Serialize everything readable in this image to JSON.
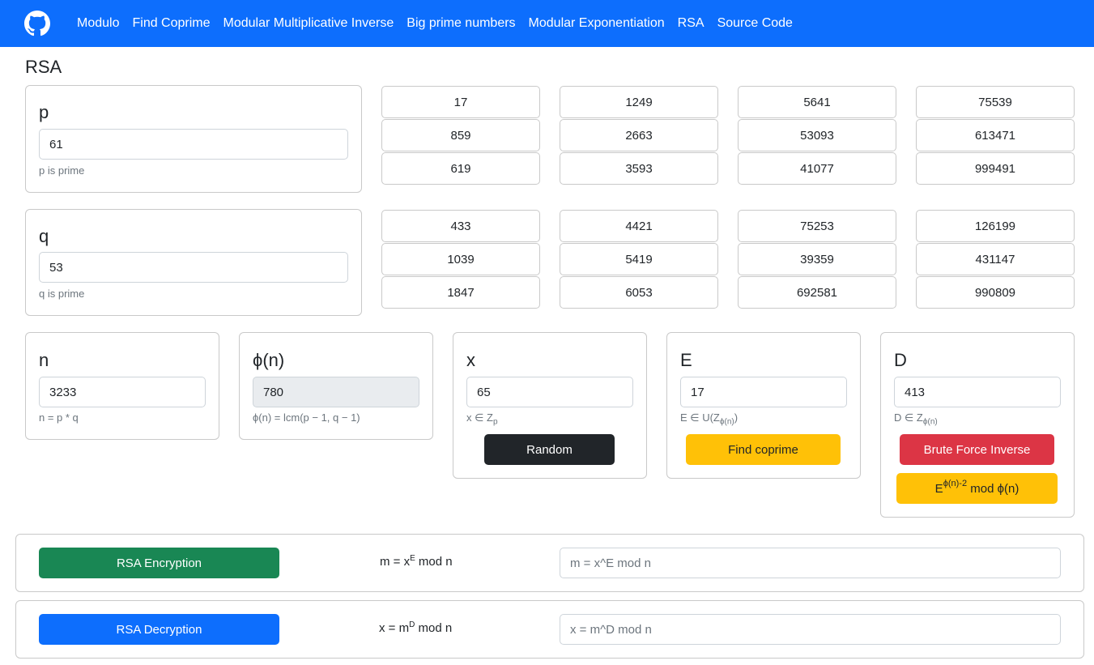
{
  "nav": {
    "items": [
      "Modulo",
      "Find Coprime",
      "Modular Multiplicative Inverse",
      "Big prime numbers",
      "Modular Exponentiation",
      "RSA",
      "Source Code"
    ]
  },
  "page": {
    "title": "RSA"
  },
  "p": {
    "label": "p",
    "value": "61",
    "help": "p is prime",
    "primes": [
      "17",
      "1249",
      "5641",
      "75539",
      "859",
      "2663",
      "53093",
      "613471",
      "619",
      "3593",
      "41077",
      "999491"
    ]
  },
  "q": {
    "label": "q",
    "value": "53",
    "help": "q is prime",
    "primes": [
      "433",
      "4421",
      "75253",
      "126199",
      "1039",
      "5419",
      "39359",
      "431147",
      "1847",
      "6053",
      "692581",
      "990809"
    ]
  },
  "n": {
    "label": "n",
    "value": "3233",
    "help": "n = p * q"
  },
  "phi": {
    "label": "ϕ(n)",
    "value": "780",
    "help": "ϕ(n) = lcm(p − 1, q − 1)"
  },
  "x": {
    "label": "x",
    "value": "65",
    "help_main": "x ∈ Z",
    "help_sub": "p",
    "random_label": "Random"
  },
  "e": {
    "label": "E",
    "value": "17",
    "help_main": "E ∈ U(Z",
    "help_sub": "ϕ(n)",
    "help_close": ")",
    "find_label": "Find coprime"
  },
  "d": {
    "label": "D",
    "value": "413",
    "help_main": "D ∈ Z",
    "help_sub": "ϕ(n)",
    "brute_label": "Brute Force Inverse",
    "exp_base": "E",
    "exp_sup": "ϕ(n)-2",
    "exp_rest": " mod ϕ(n)"
  },
  "encrypt": {
    "button": "RSA Encryption",
    "formula_pre": "m = x",
    "formula_sup": "E",
    "formula_post": " mod n",
    "placeholder": "m = x^E mod n"
  },
  "decrypt": {
    "button": "RSA Decryption",
    "formula_pre": "x = m",
    "formula_sup": "D",
    "formula_post": " mod n",
    "placeholder": "x = m^D mod n"
  }
}
